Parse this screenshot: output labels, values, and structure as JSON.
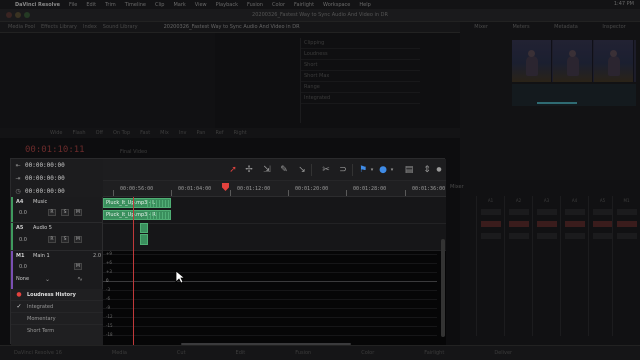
{
  "menubar": {
    "app": "DaVinci Resolve",
    "items": [
      "File",
      "Edit",
      "Trim",
      "Timeline",
      "Clip",
      "Mark",
      "View",
      "Playback",
      "Fusion",
      "Color",
      "Fairlight",
      "Workspace",
      "Help"
    ],
    "clock": "1:47 PM"
  },
  "window": {
    "title": "20200326_Fastest Way to Sync Audio And Video in DR"
  },
  "toolbar": {
    "items": [
      "Media Pool",
      "Effects Library",
      "Index",
      "Sound Library"
    ],
    "project": "20200326_Fastest Way to Sync Audio And Video in DR"
  },
  "bg_right_tabs": [
    "Mixer",
    "Meters",
    "Metadata",
    "Inspector"
  ],
  "bg_grid": [
    "Clipping",
    "Loudness",
    "Short",
    "Short Max",
    "Range",
    "Integrated"
  ],
  "bg_strip": [
    "Wide",
    "Flash",
    "Off",
    "On Top",
    "Fast",
    "Mix",
    "Inv",
    "Pan",
    "Ref",
    "Right"
  ],
  "bg_timecode": "00:01:10:11",
  "bg_timecode_label": "Final Video",
  "bg_mixer_title": "Mixer",
  "bg_mixer_cols": [
    "A1",
    "A2",
    "A3",
    "A4",
    "A5",
    "M1"
  ],
  "dock_items": [
    "DaVinci Resolve 16",
    "Media",
    "Cut",
    "Edit",
    "Fusion",
    "Color",
    "Fairlight",
    "Deliver"
  ],
  "timecodes": [
    "00:00:00:00",
    "00:00:00:00",
    "00:00:00:00"
  ],
  "ruler": [
    "00:00:56:00",
    "00:01:04:00",
    "00:01:12:00",
    "00:01:20:00",
    "00:01:28:00",
    "00:01:36:00"
  ],
  "tracks": [
    {
      "id": "A4",
      "name": "Music",
      "volume": "0.0",
      "buttons": [
        "R",
        "S",
        "M"
      ],
      "color": "#3f9a5e"
    },
    {
      "id": "A5",
      "name": "Audio 5",
      "volume": "0.0",
      "buttons": [
        "R",
        "S",
        "M"
      ],
      "color": "#3f9a5e"
    },
    {
      "id": "M1",
      "name": "Main 1",
      "volume": "0.0",
      "buttons": [
        "M"
      ],
      "channel": "2.0",
      "color": "#7a4fb3"
    }
  ],
  "main_dropdown": "None",
  "loudness_menu": {
    "title": "Loudness History",
    "items": [
      {
        "label": "Integrated",
        "checked": true
      },
      {
        "label": "Momentary",
        "checked": false
      },
      {
        "label": "Short Term",
        "checked": false
      }
    ]
  },
  "clips": [
    {
      "label": "Pluck_It_Up.mp3 - L"
    },
    {
      "label": "Pluck_It_Up.mp3 - R"
    }
  ],
  "graph_labels": [
    "+9",
    "+6",
    "+3",
    "0",
    "-3",
    "-6",
    "-9",
    "-12",
    "-15",
    "-18"
  ]
}
